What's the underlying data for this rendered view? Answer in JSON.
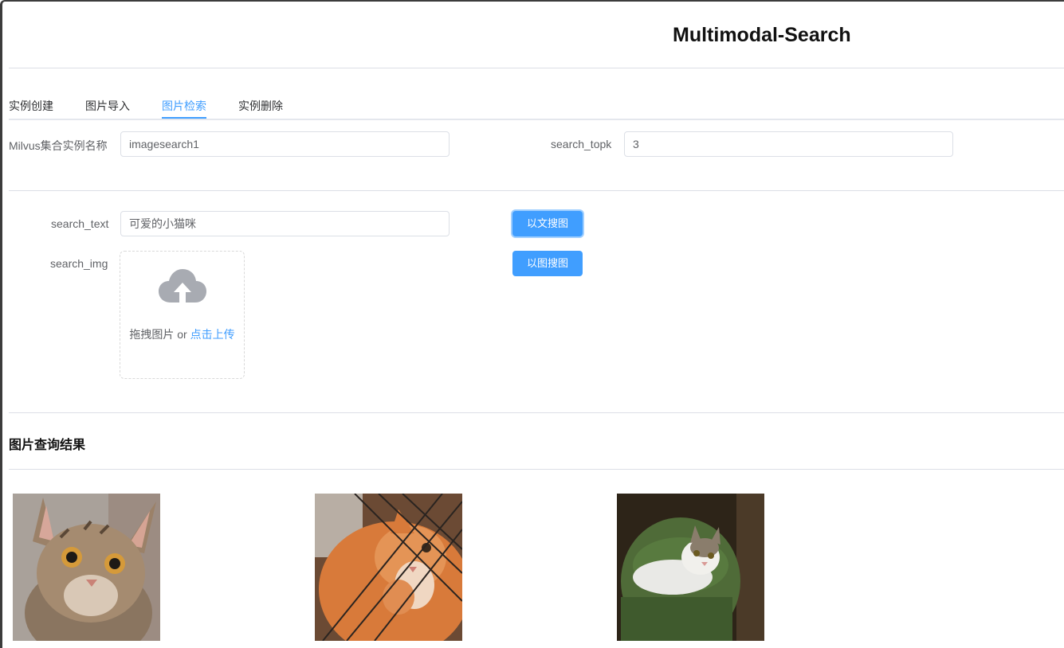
{
  "app": {
    "title": "Multimodal-Search"
  },
  "tabs": [
    {
      "label": "实例创建",
      "active": false
    },
    {
      "label": "图片导入",
      "active": false
    },
    {
      "label": "图片检索",
      "active": true
    },
    {
      "label": "实例删除",
      "active": false
    }
  ],
  "form": {
    "collection_label": "Milvus集合实例名称",
    "collection_value": "imagesearch1",
    "topk_label": "search_topk",
    "topk_value": "3",
    "search_text_label": "search_text",
    "search_text_value": "可爱的小猫咪",
    "search_img_label": "search_img",
    "text_search_button": "以文搜图",
    "image_search_button": "以图搜图",
    "upload": {
      "prefix": "拖拽图片 or ",
      "link": "点击上传",
      "icon": "cloud-upload-icon"
    }
  },
  "results": {
    "title": "图片查询结果",
    "images": [
      {
        "name": "tabby-kitten-image"
      },
      {
        "name": "orange-cat-image"
      },
      {
        "name": "white-cat-on-green-blanket-image"
      }
    ]
  },
  "colors": {
    "accent": "#409eff",
    "border": "#dcdfe6",
    "text": "#606266"
  }
}
